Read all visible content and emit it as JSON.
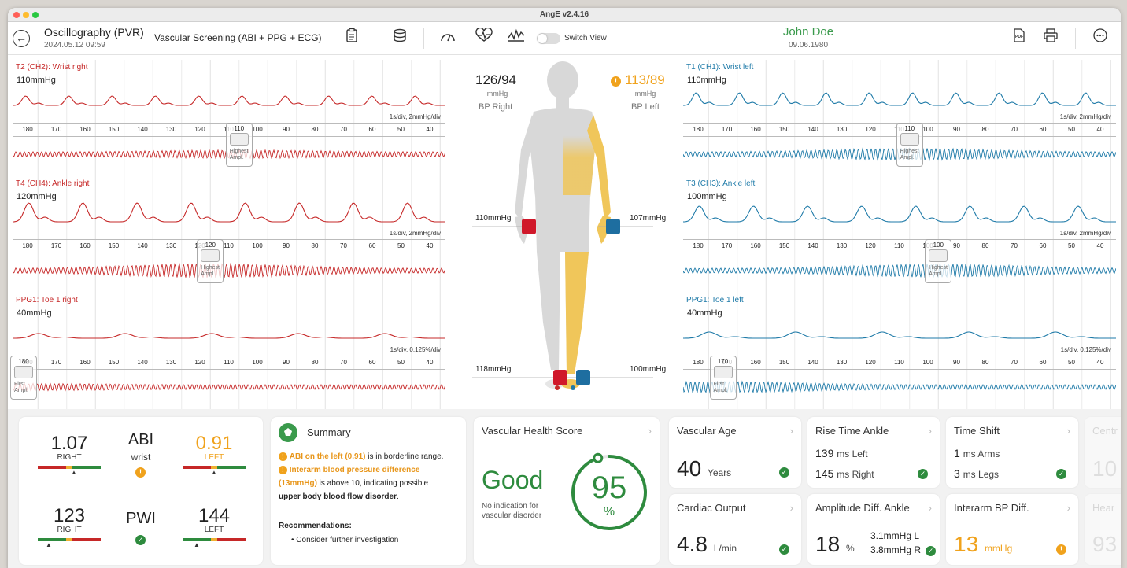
{
  "window": {
    "title": "AngE v2.4.16"
  },
  "toolbar": {
    "exam_title": "Oscillography (PVR)",
    "exam_date": "2024.05.12  09:59",
    "mode": "Vascular Screening (ABI + PPG + ECG)",
    "switch_view_label": "Switch View",
    "icons": [
      "back-icon",
      "report-icon",
      "database-icon",
      "gauge-icon",
      "heartbeat-icon",
      "waveform-icon",
      "pdf-icon",
      "print-icon",
      "more-icon"
    ]
  },
  "patient": {
    "name": "John Doe",
    "dob": "09.06.1980"
  },
  "ticks": [
    "180",
    "170",
    "160",
    "150",
    "140",
    "130",
    "120",
    "110",
    "100",
    "90",
    "80",
    "70",
    "60",
    "50",
    "40"
  ],
  "panels": {
    "t2": {
      "label": "T2 (CH2): Wrist right",
      "pressure": "110mmHg",
      "scale": "1s/div, 2mmHg/div",
      "marker_value": "110",
      "marker_label": "Highest Ampl."
    },
    "t4": {
      "label": "T4 (CH4): Ankle right",
      "pressure": "120mmHg",
      "scale": "1s/div, 2mmHg/div",
      "marker_value": "120",
      "marker_label": "Highest Ampl."
    },
    "ppg1r": {
      "label": "PPG1: Toe 1 right",
      "pressure": "40mmHg",
      "scale": "1s/div, 0.125%/div",
      "marker_value": "180",
      "marker_label": "First Ampl."
    },
    "t1": {
      "label": "T1 (CH1): Wrist left",
      "pressure": "110mmHg",
      "scale": "1s/div, 2mmHg/div",
      "marker_value": "110",
      "marker_label": "Highest Ampl."
    },
    "t3": {
      "label": "T3 (CH3): Ankle left",
      "pressure": "100mmHg",
      "scale": "1s/div, 2mmHg/div",
      "marker_value": "100",
      "marker_label": "Highest Ampl."
    },
    "ppg1l": {
      "label": "PPG1: Toe 1 left",
      "pressure": "40mmHg",
      "scale": "1s/div, 0.125%/div",
      "marker_value": "170",
      "marker_label": "First Ampl."
    }
  },
  "body": {
    "bp_right": "126/94",
    "bp_right_unit": "mmHg",
    "bp_right_label": "BP Right",
    "bp_left": "113/89",
    "bp_left_unit": "mmHg",
    "bp_left_label": "BP Left",
    "wrist_right": "110mmHg",
    "wrist_left": "107mmHg",
    "ankle_right": "118mmHg",
    "ankle_left": "100mmHg"
  },
  "abi": {
    "right_value": "1.07",
    "right_label": "RIGHT",
    "title": "ABI",
    "sub": "wrist",
    "left_value": "0.91",
    "left_label": "LEFT",
    "pwi_right_value": "123",
    "pwi_right_label": "RIGHT",
    "pwi_title": "PWI",
    "pwi_left_value": "144",
    "pwi_left_label": "LEFT"
  },
  "summary": {
    "title": "Summary",
    "l1a": "ABI on the left (0.91)",
    "l1b": " is in borderline range.",
    "l2a": "Interarm blood pressure difference",
    "l2b": "(13mmHg)",
    "l2c": " is above 10, indicating possible",
    "l2d": "upper body blood flow disorder",
    "rec_title": "Recommendations:",
    "rec1": "Consider further investigation"
  },
  "vhs": {
    "title": "Vascular Health Score",
    "status": "Good",
    "desc": "No indication for vascular disorder",
    "score": "95",
    "unit": "%",
    "score_fraction": 0.95
  },
  "vascular_age": {
    "title": "Vascular Age",
    "value": "40",
    "unit": "Years"
  },
  "rise_time": {
    "title": "Rise Time Ankle",
    "l1v": "139",
    "l1u": "ms Left",
    "l2v": "145",
    "l2u": "ms Right"
  },
  "time_shift": {
    "title": "Time Shift",
    "l1v": "1",
    "l1u": "ms Arms",
    "l2v": "3",
    "l2u": "ms Legs"
  },
  "cardiac": {
    "title": "Cardiac Output",
    "value": "4.8",
    "unit": "L/min"
  },
  "amp_diff": {
    "title": "Amplitude Diff. Ankle",
    "value": "18",
    "unit": "%",
    "l1": "3.1mmHg L",
    "l2": "3.8mmHg R"
  },
  "interarm": {
    "title": "Interarm BP Diff.",
    "value": "13",
    "unit": "mmHg"
  },
  "partial": {
    "c1": "Centr",
    "c1v": "10",
    "c2": "Hear",
    "c2v": "93"
  },
  "colors": {
    "right": "#c62828",
    "left": "#1e7aa8",
    "ok": "#2e8b3e",
    "warn": "#f0a21c"
  }
}
